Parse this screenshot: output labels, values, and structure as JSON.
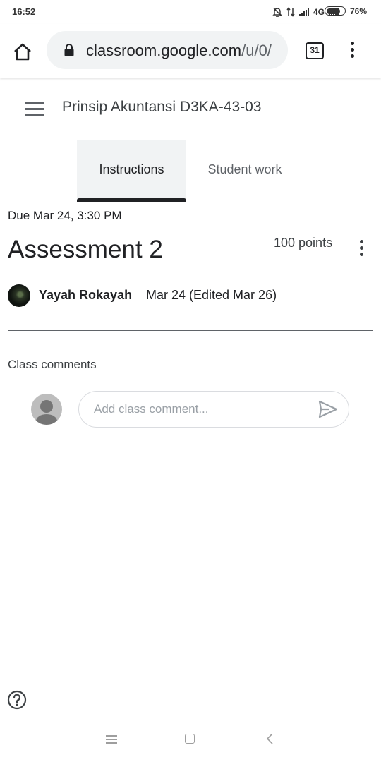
{
  "status_bar": {
    "time": "16:52",
    "network": "4G",
    "battery": "76%",
    "battery_level": 0.76,
    "icons": [
      "bell-off-icon",
      "data-arrows-icon",
      "signal-icon",
      "signal-icon",
      "battery-icon"
    ]
  },
  "browser": {
    "url_domain": "classroom.google.com",
    "url_path": "/u/0/",
    "tab_count": "31",
    "icons": [
      "home-icon",
      "lock-icon",
      "more-vert-icon"
    ]
  },
  "header": {
    "class_name": "Prinsip Akuntansi D3KA-43-03",
    "menu_icon": "hamburger-icon"
  },
  "tabs": [
    {
      "label": "Instructions",
      "active": true
    },
    {
      "label": "Student work",
      "active": false
    }
  ],
  "assignment": {
    "due": "Due Mar 24, 3:30 PM",
    "title": "Assessment 2",
    "points": "100 points",
    "author": "Yayah Rokayah",
    "date": "Mar 24 (Edited Mar 26)"
  },
  "comments": {
    "heading": "Class comments",
    "placeholder": "Add class comment...",
    "send_icon": "send-icon"
  },
  "colors": {
    "active_tab_bg": "#f1f3f4",
    "tab_indicator": "#202124",
    "text_primary": "#202124",
    "text_secondary": "#5f6368"
  }
}
